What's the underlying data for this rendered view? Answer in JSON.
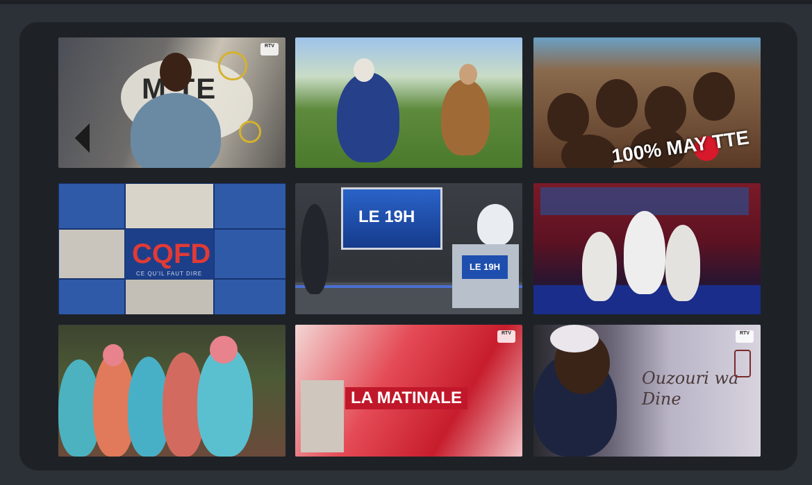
{
  "tiles": [
    {
      "name": "mayotte-show",
      "text": "M TE",
      "logo": "RTV"
    },
    {
      "name": "garden-interview",
      "logo": ""
    },
    {
      "name": "100-mayotte",
      "text": "100% MAY TTE",
      "logo": ""
    },
    {
      "name": "cqfd",
      "title": "CQFD",
      "subtitle": "CE QU'IL FAUT DIRE"
    },
    {
      "name": "le-19h",
      "title": "LE 19H"
    },
    {
      "name": "dance-show"
    },
    {
      "name": "traditional-dance"
    },
    {
      "name": "la-matinale",
      "title": "LA MATINALE",
      "logo": "RTV"
    },
    {
      "name": "ouzouri-wa-dine",
      "title": "Ouzouri wa Dine",
      "logo": "RTV"
    }
  ]
}
